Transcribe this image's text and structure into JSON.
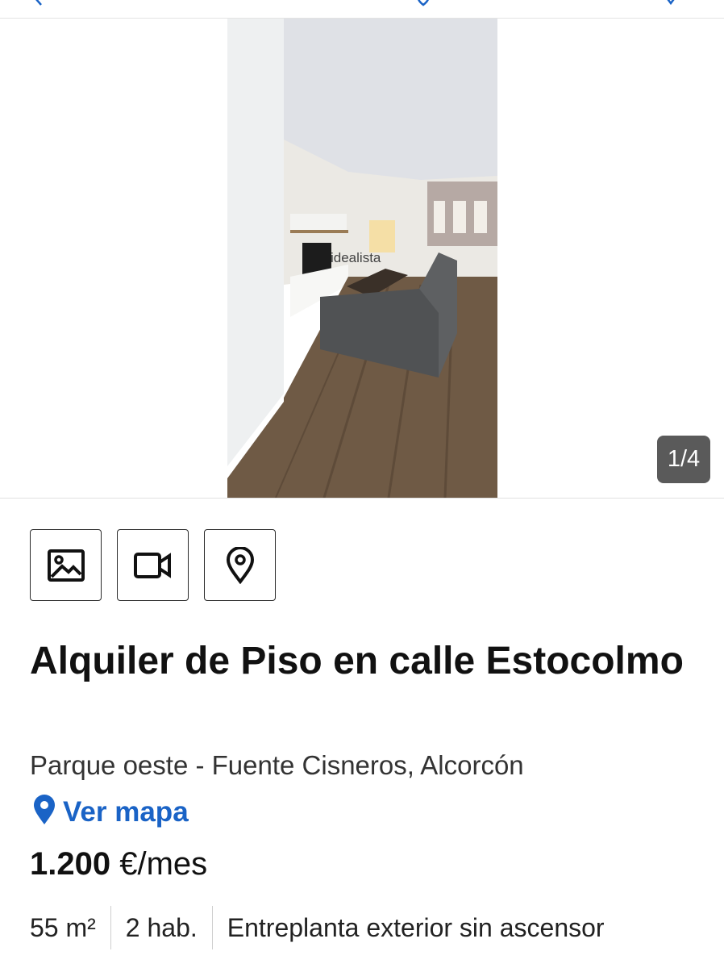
{
  "topbar": {
    "back_icon": "chevron-left-icon",
    "heart_icon": "heart-icon",
    "share_icon": "share-icon"
  },
  "gallery": {
    "counter": "1/4",
    "watermark": "idealista"
  },
  "media_buttons": [
    {
      "icon": "photos-icon"
    },
    {
      "icon": "video-icon"
    },
    {
      "icon": "map-pin-icon"
    }
  ],
  "listing": {
    "title": "Alquiler de Piso en calle Estocolmo",
    "location": "Parque oeste - Fuente Cisneros, Alcorcón",
    "map_link": "Ver mapa",
    "price_amount": "1.200",
    "price_unit": "€/mes",
    "features": [
      "55 m²",
      "2 hab.",
      "Entreplanta exterior sin ascensor"
    ]
  },
  "colors": {
    "accent": "#1a63c6",
    "counter_bg": "#5a5a5a",
    "text": "#111111"
  }
}
